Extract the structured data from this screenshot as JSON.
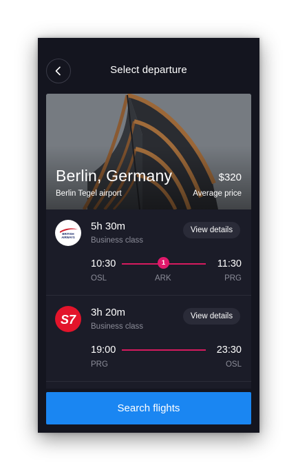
{
  "header": {
    "title": "Select departure",
    "back_icon": "chevron-left-icon"
  },
  "destination": {
    "city": "Berlin, Germany",
    "price": "$320",
    "airport": "Berlin Tegel airport",
    "price_label": "Average price"
  },
  "flights": [
    {
      "airline_logo": "british-airways-logo",
      "logo_text": [
        "BRITISH",
        "AIRWAYS"
      ],
      "duration": "5h 30m",
      "class": "Business class",
      "details_label": "View details",
      "departure_time": "10:30",
      "arrival_time": "11:30",
      "origin": "OSL",
      "stop": "ARK",
      "stop_count": "1",
      "destination": "PRG"
    },
    {
      "airline_logo": "s7-airlines-logo",
      "logo_text": "S7",
      "duration": "3h 20m",
      "class": "Business class",
      "details_label": "View details",
      "departure_time": "19:00",
      "arrival_time": "23:30",
      "origin": "PRG",
      "destination": "OSL"
    }
  ],
  "search_button": "Search flights",
  "colors": {
    "background": "#14151f",
    "card": "#1b1c28",
    "accent": "#1a86f2",
    "route": "#d81b5f",
    "s7_red": "#e3142b"
  }
}
